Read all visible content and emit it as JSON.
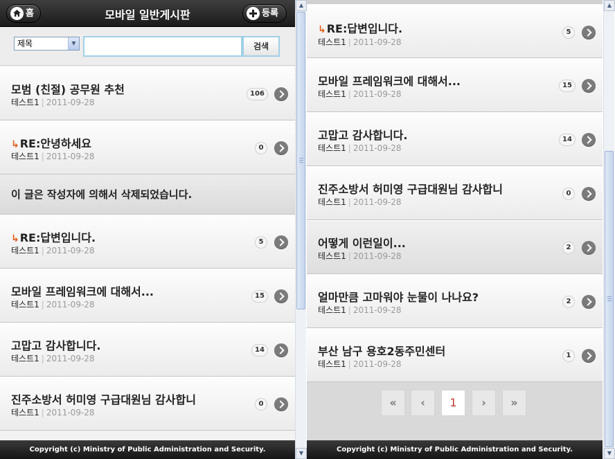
{
  "header": {
    "title": "모바일 일반게시판",
    "home_label": "홈",
    "register_label": "등록"
  },
  "search": {
    "field_selected": "제목",
    "query_value": "",
    "button_label": "검색"
  },
  "posts": {
    "p1": {
      "title": "모범 (친절) 공무원 추천",
      "author": "테스트1",
      "date": "2011-09-28",
      "count": "106"
    },
    "p2": {
      "title": "안녕하세요",
      "author": "테스트1",
      "date": "2011-09-28",
      "count": "0"
    },
    "deleted": "이 글은 작성자에 의해서 삭제되었습니다.",
    "p3": {
      "title": "답변입니다.",
      "author": "테스트1",
      "date": "2011-09-28",
      "count": "5"
    },
    "p4": {
      "title": "모바일 프레임워크에 대해서...",
      "author": "테스트1",
      "date": "2011-09-28",
      "count": "15"
    },
    "p5": {
      "title": "고맙고 감사합니다.",
      "author": "테스트1",
      "date": "2011-09-28",
      "count": "14"
    },
    "p6": {
      "title": "진주소방서 허미영 구급대원님 감사합니",
      "author": "테스트1",
      "date": "2011-09-28",
      "count": "0"
    },
    "p7": {
      "title": "어떻게 이런일이...",
      "author": "테스트1",
      "date": "2011-09-28",
      "count": "2"
    },
    "p8": {
      "title": "얼마만큼 고마워야 눈물이 나나요?",
      "author": "테스트1",
      "date": "2011-09-28",
      "count": "2"
    },
    "p9": {
      "title": "부산 남구 용호2동주민센터",
      "author": "테스트1",
      "date": "2011-09-28",
      "count": "1"
    }
  },
  "reply_prefix": "RE:",
  "reply_icon": "reply-arrow-icon",
  "pagination": {
    "first": "«",
    "prev": "‹",
    "current": "1",
    "next": "›",
    "last": "»"
  },
  "footer": {
    "copyright": "Copyright (c) Ministry of Public Administration and Security."
  },
  "colors": {
    "header_bg": "#2a2a2a",
    "reply_arrow": "#e25d1a",
    "current_page": "#c0392b",
    "search_border": "#9fd0e6"
  }
}
